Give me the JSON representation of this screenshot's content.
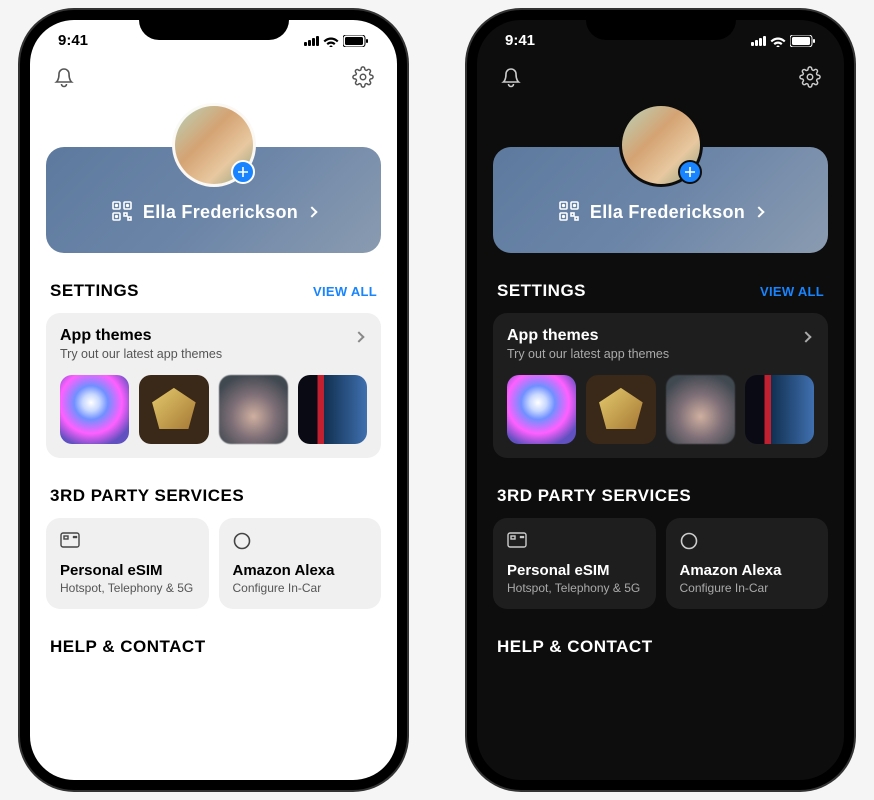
{
  "status": {
    "time": "9:41"
  },
  "profile": {
    "name": "Ella Frederickson"
  },
  "settings": {
    "title": "SETTINGS",
    "view_all": "VIEW ALL",
    "app_themes": {
      "title": "App themes",
      "subtitle": "Try out our latest app themes",
      "tiles": [
        "holographic-sphere",
        "gold-diamond",
        "blurred-gradient",
        "striped-dark"
      ]
    }
  },
  "services": {
    "title": "3RD PARTY SERVICES",
    "items": [
      {
        "title": "Personal eSIM",
        "subtitle": "Hotspot, Telephony & 5G",
        "icon": "sim"
      },
      {
        "title": "Amazon Alexa",
        "subtitle": "Configure In-Car",
        "icon": "alexa"
      }
    ]
  },
  "help": {
    "title": "HELP & CONTACT"
  },
  "variants": [
    "light",
    "dark"
  ]
}
